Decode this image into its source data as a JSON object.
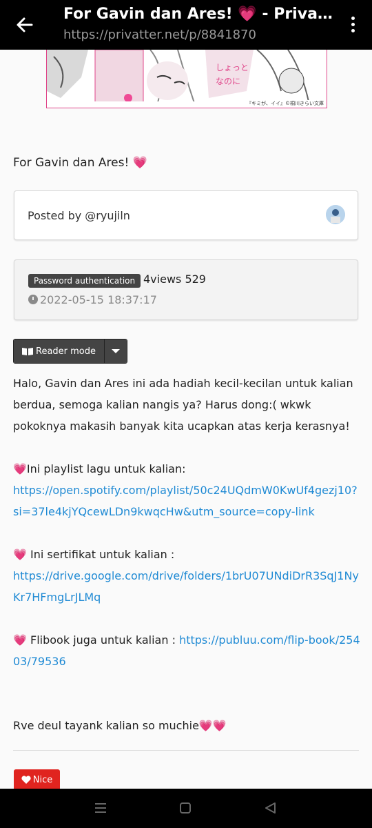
{
  "topbar": {
    "title": "For Gavin dan Ares! 💗 - Privatter",
    "url": "https://privatter.net/p/8841870"
  },
  "banner": {
    "caption": "『キミが、イイ』©桐川きらい文庫"
  },
  "post": {
    "title": "For Gavin dan Ares!",
    "title_emoji": "💗"
  },
  "author": {
    "posted_by": "Posted by @ryujiln"
  },
  "meta": {
    "badge": "Password authentication",
    "views": "4views 529",
    "date": "2022-05-15 18:37:17"
  },
  "toolbar": {
    "reader_label": "Reader mode"
  },
  "content": {
    "intro": "Halo, Gavin dan Ares ini ada hadiah kecil-kecilan untuk kalian berdua, semoga kalian nangis ya? Harus dong:( wkwk pokoknya makasih banyak kita ucapkan atas kerja kerasnya!",
    "playlist_label": "💗Ini playlist lagu untuk kalian:",
    "playlist_link": "https://open.spotify.com/playlist/50c24UQdmW0KwUf4gezj10?si=37le4kjYQcewLDn9kwqcHw&utm_source=copy-link",
    "certificate_label": "💗 Ini sertifikat untuk kalian :",
    "certificate_link": "https://drive.google.com/drive/folders/1brU07UNdiDrR3SqJ1NyKr7HFmgLrJLMq",
    "flipbook_label": "💗 Flibook juga untuk kalian : ",
    "flipbook_link": "https://publuu.com/flip-book/25403/79536",
    "closing": "Rve deul tayank kalian so muchie💗💗"
  },
  "reaction": {
    "nice_label": "Nice"
  },
  "colors": {
    "accent_link": "#1f8ad4",
    "nice_red": "#e0241f",
    "heart_pink": "#ef4a95"
  },
  "icons": [
    "back-arrow-icon",
    "more-vertical-icon",
    "clock-icon",
    "book-icon",
    "caret-down-icon",
    "heart-icon",
    "recent-apps-icon",
    "home-icon",
    "back-triangle-icon"
  ]
}
